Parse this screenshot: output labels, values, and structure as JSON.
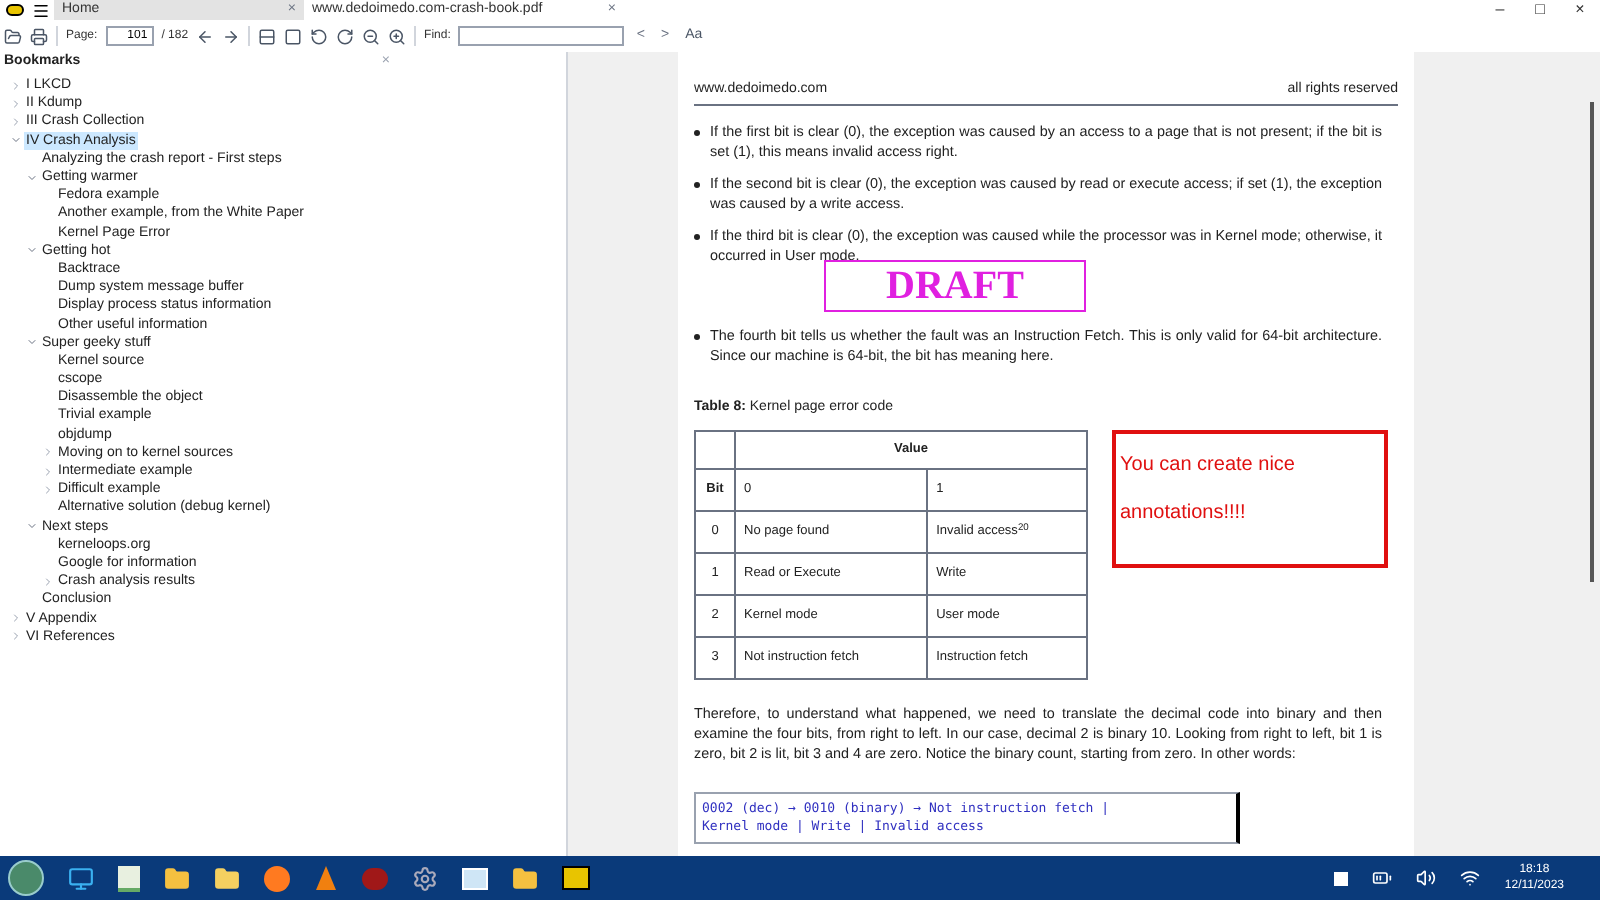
{
  "tabs": [
    {
      "label": "Home",
      "selected": false,
      "close": "×"
    },
    {
      "label": "www.dedoimedo.com-crash-book.pdf",
      "selected": true,
      "close": "×"
    }
  ],
  "window_controls": [
    "–",
    "□",
    "×"
  ],
  "toolbar": {
    "page_label": "Page:",
    "page_value": "101",
    "page_total": "/ 182",
    "find_label": "Find:",
    "prev": "<",
    "next": ">",
    "match_case": "Aa"
  },
  "bookmarks": {
    "title": "Bookmarks",
    "close": "×",
    "items": [
      {
        "label": "I LKCD",
        "expanded": false,
        "selected": false
      },
      {
        "label": "II Kdump",
        "expanded": false,
        "selected": false
      },
      {
        "label": "III Crash Collection",
        "expanded": false,
        "selected": false
      },
      {
        "label": "IV Crash Analysis",
        "expanded": true,
        "selected": true,
        "children": [
          {
            "label": "Analyzing the crash report - First steps",
            "selected": false
          },
          {
            "label": "Getting warmer",
            "expanded": true,
            "selected": false,
            "children": [
              {
                "label": "Fedora example",
                "selected": false
              },
              {
                "label": "Another example, from the White Paper",
                "selected": false
              },
              {
                "label": "Kernel Page Error",
                "selected": false
              }
            ]
          },
          {
            "label": "Getting hot",
            "expanded": true,
            "selected": false,
            "children": [
              {
                "label": "Backtrace",
                "selected": false
              },
              {
                "label": "Dump system message buffer",
                "selected": false
              },
              {
                "label": "Display process status information",
                "selected": false
              },
              {
                "label": "Other useful information",
                "selected": false
              }
            ]
          },
          {
            "label": "Super geeky stuff",
            "expanded": true,
            "selected": false,
            "children": [
              {
                "label": "Kernel source",
                "selected": false
              },
              {
                "label": "cscope",
                "selected": false
              },
              {
                "label": "Disassemble the object",
                "selected": false
              },
              {
                "label": "Trivial example",
                "selected": false
              },
              {
                "label": "objdump",
                "selected": false
              },
              {
                "label": "Moving on to kernel sources",
                "expanded": false,
                "selected": false
              },
              {
                "label": "Intermediate example",
                "expanded": false,
                "selected": false
              },
              {
                "label": "Difficult example",
                "expanded": false,
                "selected": false
              },
              {
                "label": "Alternative solution (debug kernel)",
                "selected": false
              }
            ]
          },
          {
            "label": "Next steps",
            "expanded": true,
            "selected": false,
            "children": [
              {
                "label": "kerneloops.org",
                "selected": false
              },
              {
                "label": "Google for information",
                "selected": false
              },
              {
                "label": "Crash analysis results",
                "expanded": false,
                "selected": false
              }
            ]
          },
          {
            "label": "Conclusion",
            "selected": false
          }
        ]
      },
      {
        "label": "V Appendix",
        "expanded": false,
        "selected": false
      },
      {
        "label": "VI References",
        "expanded": false,
        "selected": false
      }
    ]
  },
  "document": {
    "header_left": "www.dedoimedo.com",
    "header_right": "all rights reserved",
    "bullets": [
      "If the first bit is clear (0), the exception was caused by an access to a page that is not present; if the bit is set (1), this means invalid access right.",
      "If the second bit is clear (0), the exception was caused by read or execute access; if set (1), the exception was caused by a write access.",
      "If the third bit is clear (0), the exception was caused while the processor was in Kernel mode; otherwise, it occurred in User mode.",
      "The fourth bit tells us whether the fault was an Instruction Fetch. This is only valid for 64-bit architecture. Since our machine is 64-bit, the bit has meaning here."
    ],
    "stamp": "DRAFT",
    "table_caption_label": "Table 8:",
    "table_caption": "Kernel page error code",
    "table": {
      "group_header": "Value",
      "header": [
        "Bit",
        "0",
        "1"
      ],
      "rows": [
        [
          "0",
          "No page found",
          "Invalid access$^{20}$"
        ],
        [
          "1",
          "Read or Execute",
          "Write"
        ],
        [
          "2",
          "Kernel mode",
          "User mode"
        ],
        [
          "3",
          "Not instruction fetch",
          "Instruction fetch"
        ]
      ]
    },
    "annotation": "You can create nice annotations!!!!",
    "paragraph": "Therefore, to understand what happened, we need to translate the decimal code into binary and then examine the four bits, from right to left. In our case, decimal 2 is binary 10. Looking from right to left, bit 1 is zero, bit 2 is lit, bit 3 and 4 are zero. Notice the binary count, starting from zero. In other words:",
    "code": [
      "0002 (dec) → 0010 (binary) → Not instruction fetch |",
      "Kernel mode | Write | Invalid access"
    ]
  },
  "taskbar": {
    "time": "18:18",
    "date": "12/11/2023"
  }
}
